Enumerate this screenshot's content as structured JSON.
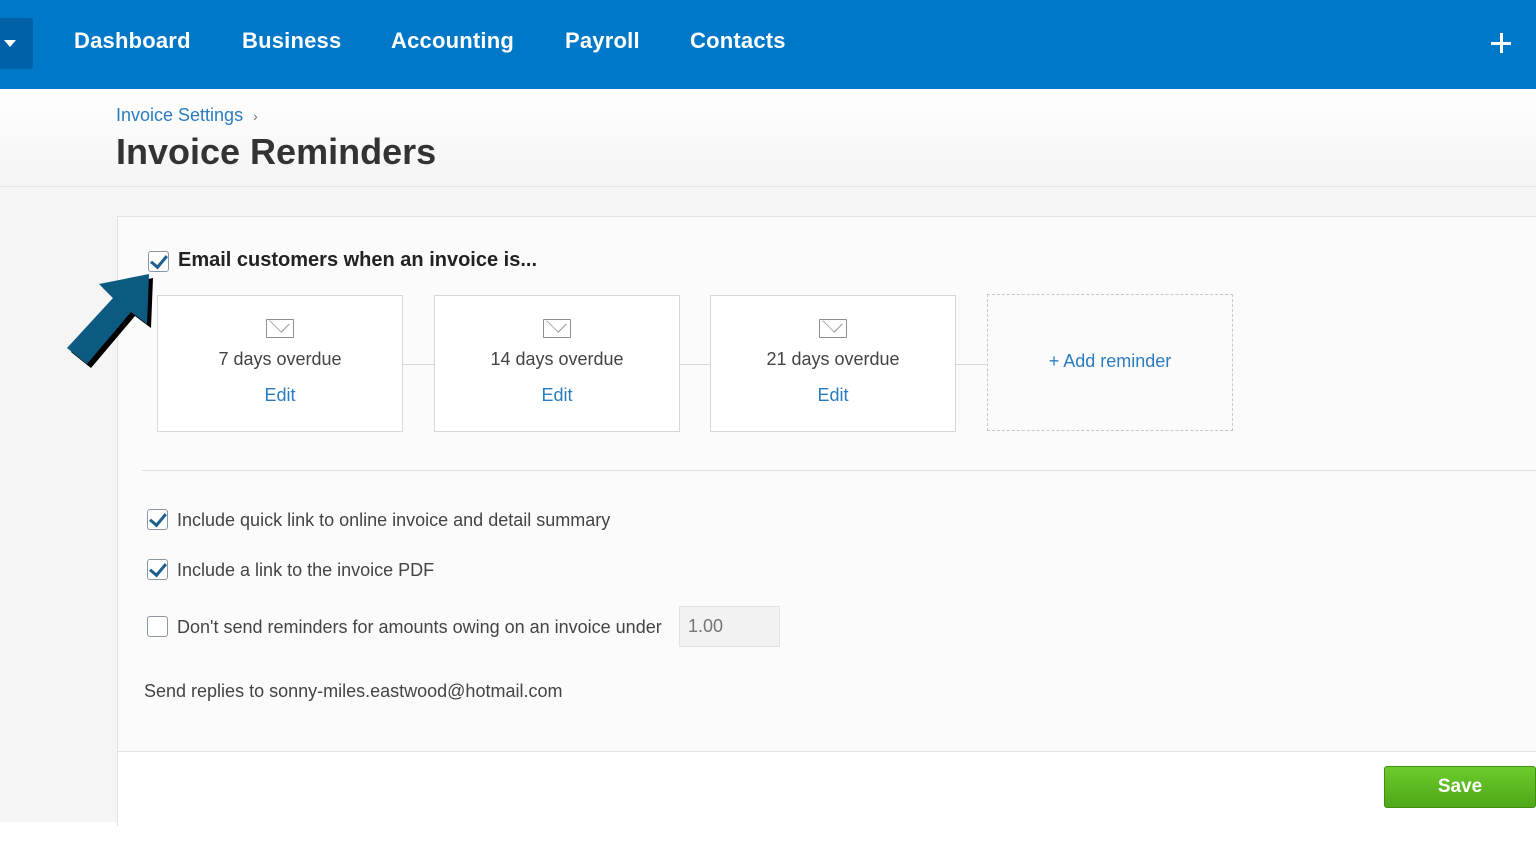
{
  "nav": {
    "items": [
      "Dashboard",
      "Business",
      "Accounting",
      "Payroll",
      "Contacts"
    ]
  },
  "breadcrumb": {
    "parent": "Invoice Settings",
    "separator": "›"
  },
  "page": {
    "title": "Invoice Reminders"
  },
  "reminders": {
    "enabled": true,
    "label": "Email customers when an invoice is...",
    "items": [
      {
        "days": "7 days overdue",
        "edit": "Edit"
      },
      {
        "days": "14 days overdue",
        "edit": "Edit"
      },
      {
        "days": "21 days overdue",
        "edit": "Edit"
      }
    ],
    "add_label": "+ Add reminder"
  },
  "options": {
    "quick_link": {
      "checked": true,
      "label": "Include quick link to online invoice and detail summary"
    },
    "pdf_link": {
      "checked": true,
      "label": "Include a link to the invoice PDF"
    },
    "min_amount": {
      "checked": false,
      "label": "Don't send reminders for amounts owing on an invoice under",
      "placeholder": "1.00"
    }
  },
  "replies": "Send replies to sonny-miles.eastwood@hotmail.com",
  "save_label": "Save",
  "colors": {
    "nav_bg": "#0078c8",
    "link": "#2a7cc0",
    "save_bg": "#5cb820",
    "annotation_arrow": "#0d5a80"
  }
}
